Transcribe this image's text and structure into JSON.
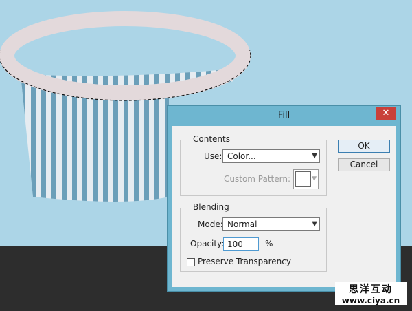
{
  "dialog": {
    "title": "Fill",
    "close_glyph": "✕",
    "contents": {
      "legend": "Contents",
      "use_label": "Use:",
      "use_value": "Color...",
      "custom_pattern_label": "Custom Pattern:"
    },
    "blending": {
      "legend": "Blending",
      "mode_label": "Mode:",
      "mode_value": "Normal",
      "opacity_label": "Opacity:",
      "opacity_value": "100",
      "opacity_unit": "%",
      "preserve_label": "Preserve Transparency",
      "preserve_checked": false
    },
    "buttons": {
      "ok": "OK",
      "cancel": "Cancel"
    }
  },
  "watermark": {
    "chinese": "思洋互动",
    "url": "www.ciya.cn"
  },
  "colors": {
    "canvas_bg": "#acd5e7",
    "workspace": "#2d2d2d",
    "dialog_frame": "#6eb6d0",
    "close_red": "#c9403a",
    "stripe_blue": "#6b9fb9",
    "stripe_white": "#e6ecf1",
    "rim": "#e3d9db"
  },
  "icons": {
    "dropdown": "chevron-down-icon",
    "close": "close-icon"
  }
}
